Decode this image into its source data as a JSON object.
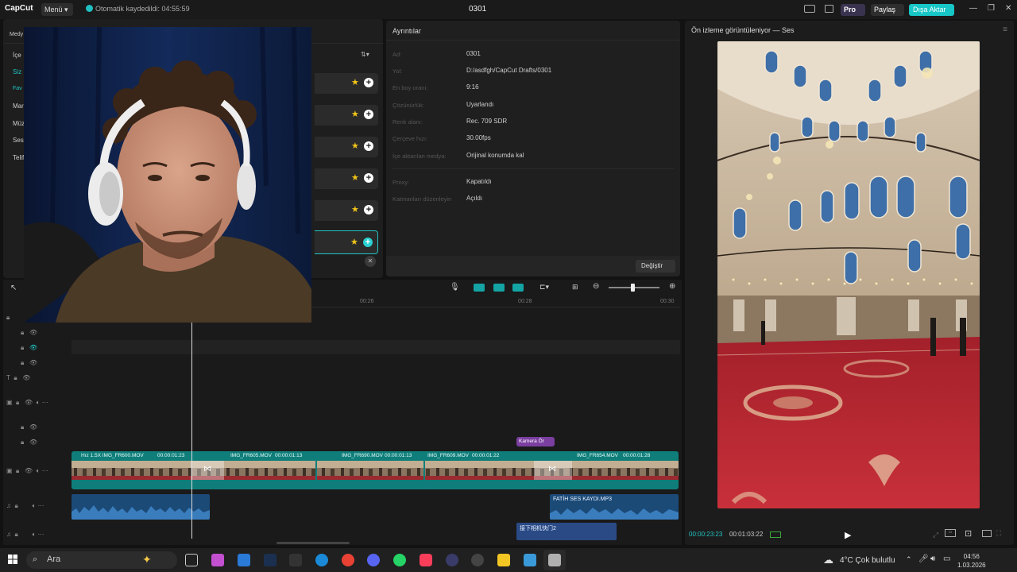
{
  "titlebar": {
    "logo": "CapCut",
    "menu": "Menü",
    "autosave": "Otomatik kaydedildi: 04:55:59",
    "project_title": "0301",
    "pro": "Pro",
    "share": "Paylaş",
    "export": "Dışa Aktar"
  },
  "left": {
    "tab_label": "Medy",
    "side_items": [
      "İçe",
      "Siz",
      "Fav",
      "Mar",
      "Müz",
      "Ses",
      "Telif"
    ]
  },
  "details": {
    "title": "Ayrıntılar",
    "rows": [
      {
        "label": "Ad:",
        "value": "0301"
      },
      {
        "label": "Yol:",
        "value": "D:/asdfgh/CapCut Drafts/0301"
      },
      {
        "label": "En boy oranı:",
        "value": "9:16"
      },
      {
        "label": "Çözünürlük:",
        "value": "Uyarlandı"
      },
      {
        "label": "Renk alanı:",
        "value": "Rec. 709 SDR"
      },
      {
        "label": "Çerçeve hızı:",
        "value": "30.00fps"
      },
      {
        "label": "İçe aktarılan medya:",
        "value": "Orijinal konumda kal"
      },
      {
        "label": "Proxy:",
        "value": "Kapatıldı"
      },
      {
        "label": "Katmanları düzenleyin",
        "value": "Açıldı"
      }
    ],
    "change_button": "Değiştir"
  },
  "preview": {
    "title": "Ön izleme görüntüleniyor — Ses",
    "current_time": "00:00:23:23",
    "total_time": "00:01:03:22"
  },
  "timeline": {
    "ruler": [
      "00:26",
      "00:28",
      "00:30"
    ],
    "clips": [
      {
        "name": "Hız 1.5X  IMG_FR600.MOV",
        "duration": "00:00:01:23"
      },
      {
        "name": "IMG_FR605.MOV",
        "duration": "00:00:01:13"
      },
      {
        "name": "IMG_FR690.MOV",
        "duration": "00:00:01:13"
      },
      {
        "name": "IMG_FR609.MOV",
        "duration": "00:00:01:22"
      },
      {
        "name": "IMG_FR654.MOV",
        "duration": "00:00:01:28"
      }
    ],
    "kamera": "Kamera Ör",
    "audio1": "FATİH SES KAYDI.MP3",
    "audio2": "接下相机快门2"
  },
  "taskbar": {
    "search": "Ara",
    "weather": "4°C  Çok bulutlu",
    "time": "04:56",
    "date": "1.03.2026"
  }
}
